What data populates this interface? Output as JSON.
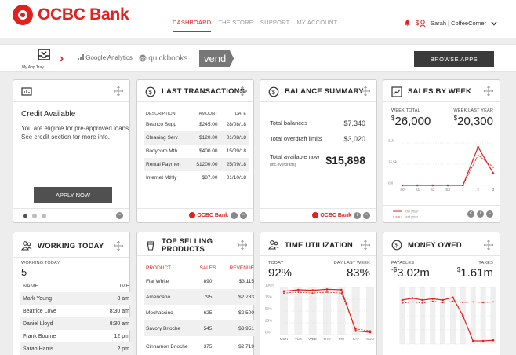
{
  "brand": {
    "name": "OCBC Bank",
    "accent": "#e2201c"
  },
  "nav": {
    "tabs": [
      {
        "label": "DASHBOARD",
        "active": true
      },
      {
        "label": "THE STORE",
        "active": false
      },
      {
        "label": "SUPPORT",
        "active": false
      },
      {
        "label": "MY ACCOUNT",
        "active": false
      }
    ],
    "user": "Sarah | CoffeeCorner",
    "icons": [
      "bell-icon",
      "dollar-user-icon",
      "chevron-down-icon"
    ]
  },
  "tray": {
    "label": "My App Tray",
    "apps": [
      "Google Analytics",
      "quickbooks",
      "vend"
    ],
    "browse_label": "BROWSE APPS"
  },
  "credit": {
    "title": "Credit Available",
    "body": "You are eligible for pre-approved loans. See credit section for more info.",
    "button": "APPLY NOW",
    "carousel_pages": 3,
    "active_page": 1
  },
  "transactions": {
    "title": "LAST TRANSACTIONS",
    "headers": [
      "DESCRIPTION",
      "AMOUNT",
      "DATE"
    ],
    "rows": [
      [
        "Beanco Supp",
        "$245.00",
        "28/08/18"
      ],
      [
        "Cleaning Serv",
        "$120.00",
        "01/08/18"
      ],
      [
        "Bodycorp Mth",
        "$400.00",
        "15/09/18"
      ],
      [
        "Rental Paymen",
        "$1200.00",
        "25/09/18"
      ],
      [
        "Internet Mthly",
        "$87.00",
        "01/10/18"
      ]
    ],
    "footer_brand": "OCBC Bank"
  },
  "balance": {
    "title": "BALANCE SUMMARY",
    "total_balances_label": "Total balances",
    "total_balances": "$7,340",
    "overdraft_label": "Total overdraft limits",
    "overdraft": "$3,020",
    "available_label": "Total available now",
    "available_sub": "(inc.overdrafts)",
    "available": "$15,898",
    "footer_brand": "OCBC Bank"
  },
  "sales": {
    "title": "SALES BY WEEK",
    "week_total_label": "WEEK TOTAL",
    "week_total_cur": "$",
    "week_total": "26,000",
    "last_year_label": "WEEK LAST YEAR",
    "last_year_cur": "$",
    "last_year": "20,300"
  },
  "working": {
    "title": "WORKING TODAY",
    "count_label": "WORKING TODAY",
    "count": "5",
    "headers": [
      "NAME",
      "TIME"
    ],
    "rows": [
      [
        "Mark Young",
        "8 am"
      ],
      [
        "Beatrice Love",
        "8:30 am"
      ],
      [
        "Daniel Lloyd",
        "8:30 am"
      ],
      [
        "Frank Bourne",
        "12 pm"
      ],
      [
        "Sarah Harris",
        "2 pm"
      ]
    ]
  },
  "top_selling": {
    "title_line1": "TOP SELLING",
    "title_line2": "PRODUCTS",
    "headers": [
      "PRODUCT",
      "SALES",
      "REVENUE"
    ],
    "rows": [
      [
        "Flat White",
        "890",
        "$3,115"
      ],
      [
        "Americano",
        "795",
        "$2,783"
      ],
      [
        "Mochaccino",
        "625",
        "$2,500"
      ],
      [
        "Savory Brioche",
        "545",
        "$3,951"
      ],
      [
        "Cinnamon Brioche",
        "375",
        "$2,719"
      ]
    ]
  },
  "time_util": {
    "title": "TIME UTILIZATION",
    "today_label": "TODAY",
    "today": "92%",
    "last_week_label": "DAY LAST WEEK",
    "last_week": "83%"
  },
  "money": {
    "title": "MONEY OWED",
    "payables_label": "PAYABLES",
    "payables_prefix": "-$",
    "payables": "3.02m",
    "taxes_label": "TAXES",
    "taxes_prefix": "$",
    "taxes": "1.61m"
  },
  "chart_data": [
    {
      "type": "line",
      "title": "SALES BY WEEK",
      "categories": [
        "S0",
        "S1",
        "S2",
        "S3",
        "1",
        "2",
        "3"
      ],
      "ytick_labels": [
        "21k",
        "15.5k",
        "0.0"
      ],
      "series": [
        {
          "name": "this year",
          "values": [
            0,
            0,
            0,
            0,
            0,
            19,
            6
          ],
          "style": "solid",
          "color": "#e2201c"
        },
        {
          "name": "last year",
          "values": [
            0,
            0,
            0,
            0,
            0,
            15,
            9
          ],
          "style": "dashed",
          "color": "#e2201c"
        }
      ],
      "ylim": [
        0,
        21
      ]
    },
    {
      "type": "line",
      "title": "TIME UTILIZATION",
      "categories": [
        "MON",
        "TUE",
        "WED",
        "THU",
        "FRI",
        "SAT",
        "SUN"
      ],
      "ytick_labels": [
        "100%",
        "75%",
        "50%",
        "25%",
        "0%"
      ],
      "series": [
        {
          "values": [
            92,
            95,
            94,
            96,
            95,
            8,
            5
          ],
          "style": "solid",
          "color": "#e2201c"
        },
        {
          "values": [
            88,
            90,
            88,
            90,
            88,
            12,
            8
          ],
          "style": "dashed",
          "color": "#e2201c"
        }
      ],
      "ylim": [
        0,
        100
      ]
    },
    {
      "type": "line",
      "title": "MONEY OWED",
      "categories": [
        "",
        "",
        "",
        "",
        "",
        "",
        "",
        "",
        "",
        ""
      ],
      "series": [
        {
          "values": [
            7,
            7.3,
            7,
            7.2,
            7,
            7.4,
            4.5,
            0.5,
            0.5,
            0.6
          ],
          "style": "solid",
          "color": "#e2201c"
        },
        {
          "values": [
            6.5,
            6.7,
            6.5,
            6.8,
            6.6,
            6.8,
            6.6,
            6.7,
            6.6,
            6.7
          ],
          "style": "dashed",
          "color": "#e2201c"
        }
      ],
      "ylim": [
        0,
        9
      ]
    }
  ]
}
